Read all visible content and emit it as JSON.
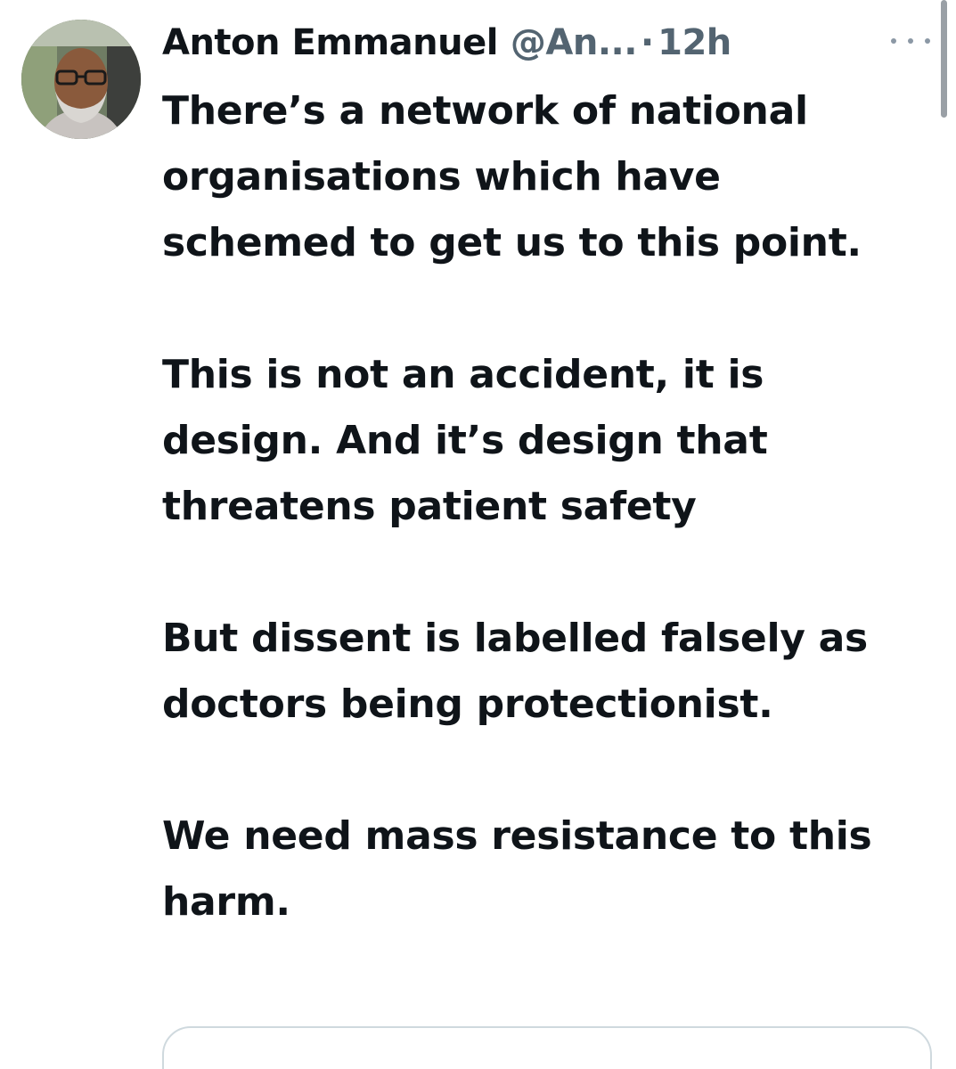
{
  "post": {
    "author": {
      "name": "Anton Emmanuel",
      "handle": "@An...",
      "separator": "·",
      "time": "12h",
      "avatar_icon": "profile-photo"
    },
    "more_icon": "more-horizontal-icon",
    "paragraphs": [
      "There’s a network of national organisations which have schemed to get us to this point.",
      "This is not an accident, it is design. And it’s design that threatens patient safety",
      "But dissent is labelled falsely as doctors being protectionist.",
      "We need mass resistance to this harm."
    ]
  },
  "colors": {
    "text_primary": "#0f1419",
    "text_secondary": "#536471",
    "border": "#cfd9de"
  }
}
